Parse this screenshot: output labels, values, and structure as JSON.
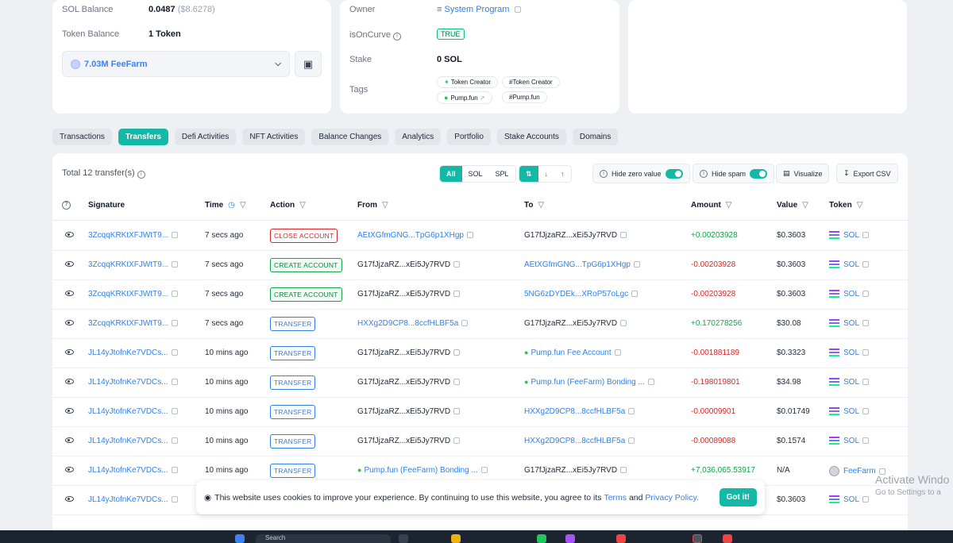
{
  "account": {
    "sol_balance_label": "SOL Balance",
    "sol_balance_value": "0.0487",
    "sol_balance_usd": "($8.6278)",
    "token_balance_label": "Token Balance",
    "token_balance_value": "1 Token",
    "token_select_value": "7.03M FeeFarm",
    "owner_label": "Owner",
    "owner_value": "System Program",
    "is_on_curve_label": "isOnCurve",
    "is_on_curve_value": "TRUE",
    "stake_label": "Stake",
    "stake_value": "0 SOL",
    "tags_label": "Tags",
    "tags": [
      "Token Creator",
      "#Token Creator",
      "Pump.fun",
      "#Pump.fun"
    ]
  },
  "tabs": [
    "Transactions",
    "Transfers",
    "Defi Activities",
    "NFT Activities",
    "Balance Changes",
    "Analytics",
    "Portfolio",
    "Stake Accounts",
    "Domains"
  ],
  "active_tab": "Transfers",
  "toolbar": {
    "total_label": "Total 12 transfer(s)",
    "filter_options": [
      "All",
      "SOL",
      "SPL"
    ],
    "hide_zero_label": "Hide zero value",
    "hide_spam_label": "Hide spam",
    "visualize_label": "Visualize",
    "export_label": "Export CSV"
  },
  "columns": [
    "Signature",
    "Time",
    "Action",
    "From",
    "To",
    "Amount",
    "Value",
    "Token"
  ],
  "rows": [
    {
      "signature": "3ZcqqKRKtXFJWtT9...",
      "time": "7 secs ago",
      "action": "CLOSE ACCOUNT",
      "from": "AEtXGfmGNG...TpG6p1XHgp",
      "to": "G17fJjzaRZ...xEi5Jy7RVD",
      "amount": "+0.00203928",
      "value": "$0.3603",
      "token": "SOL"
    },
    {
      "signature": "3ZcqqKRKtXFJWtT9...",
      "time": "7 secs ago",
      "action": "CREATE ACCOUNT",
      "from": "G17fJjzaRZ...xEi5Jy7RVD",
      "to": "AEtXGfmGNG...TpG6p1XHgp",
      "amount": "-0.00203928",
      "value": "$0.3603",
      "token": "SOL"
    },
    {
      "signature": "3ZcqqKRKtXFJWtT9...",
      "time": "7 secs ago",
      "action": "CREATE ACCOUNT",
      "from": "G17fJjzaRZ...xEi5Jy7RVD",
      "to": "5NG6zDYDEk...XRoP57oLgc",
      "amount": "-0.00203928",
      "value": "$0.3603",
      "token": "SOL"
    },
    {
      "signature": "3ZcqqKRKtXFJWtT9...",
      "time": "7 secs ago",
      "action": "TRANSFER",
      "from": "HXXg2D9CP8...8ccfHLBF5a",
      "to": "G17fJjzaRZ...xEi5Jy7RVD",
      "amount": "+0.170278256",
      "value": "$30.08",
      "token": "SOL"
    },
    {
      "signature": "JL14yJtofnKe7VDCs...",
      "time": "10 mins ago",
      "action": "TRANSFER",
      "from": "G17fJjzaRZ...xEi5Jy7RVD",
      "to": "Pump.fun Fee Account",
      "amount": "-0.001881189",
      "value": "$0.3323",
      "token": "SOL"
    },
    {
      "signature": "JL14yJtofnKe7VDCs...",
      "time": "10 mins ago",
      "action": "TRANSFER",
      "from": "G17fJjzaRZ...xEi5Jy7RVD",
      "to": "Pump.fun (FeeFarm) Bonding ...",
      "amount": "-0.198019801",
      "value": "$34.98",
      "token": "SOL"
    },
    {
      "signature": "JL14yJtofnKe7VDCs...",
      "time": "10 mins ago",
      "action": "TRANSFER",
      "from": "G17fJjzaRZ...xEi5Jy7RVD",
      "to": "HXXg2D9CP8...8ccfHLBF5a",
      "amount": "-0.00009901",
      "value": "$0.01749",
      "token": "SOL"
    },
    {
      "signature": "JL14yJtofnKe7VDCs...",
      "time": "10 mins ago",
      "action": "TRANSFER",
      "from": "G17fJjzaRZ...xEi5Jy7RVD",
      "to": "HXXg2D9CP8...8ccfHLBF5a",
      "amount": "-0.00089088",
      "value": "$0.1574",
      "token": "SOL"
    },
    {
      "signature": "JL14yJtofnKe7VDCs...",
      "time": "10 mins ago",
      "action": "TRANSFER",
      "from": "Pump.fun (FeeFarm) Bonding ...",
      "to": "G17fJjzaRZ...xEi5Jy7RVD",
      "amount": "+7,036,065.53917",
      "value": "N/A",
      "token": "FeeFarm"
    },
    {
      "signature": "JL14yJtofnKe7VDCs...",
      "time": "",
      "action": "",
      "from": "",
      "to": "",
      "amount": "",
      "value": "$0.3603",
      "token": "SOL"
    }
  ],
  "cookie": {
    "text": "This website uses cookies to improve your experience. By continuing to use this website, you agree to its",
    "terms": "Terms",
    "and": "and",
    "privacy": "Privacy Policy.",
    "button": "Got it!"
  },
  "watermark": {
    "line1": "Activate Windo",
    "line2": "Go to Settings to a"
  },
  "taskbar": {
    "search_placeholder": "Search"
  },
  "colors": {
    "accent": "#14b8a6",
    "link": "#2f80ed",
    "positive": "#16a34a",
    "negative": "#dc2626"
  }
}
